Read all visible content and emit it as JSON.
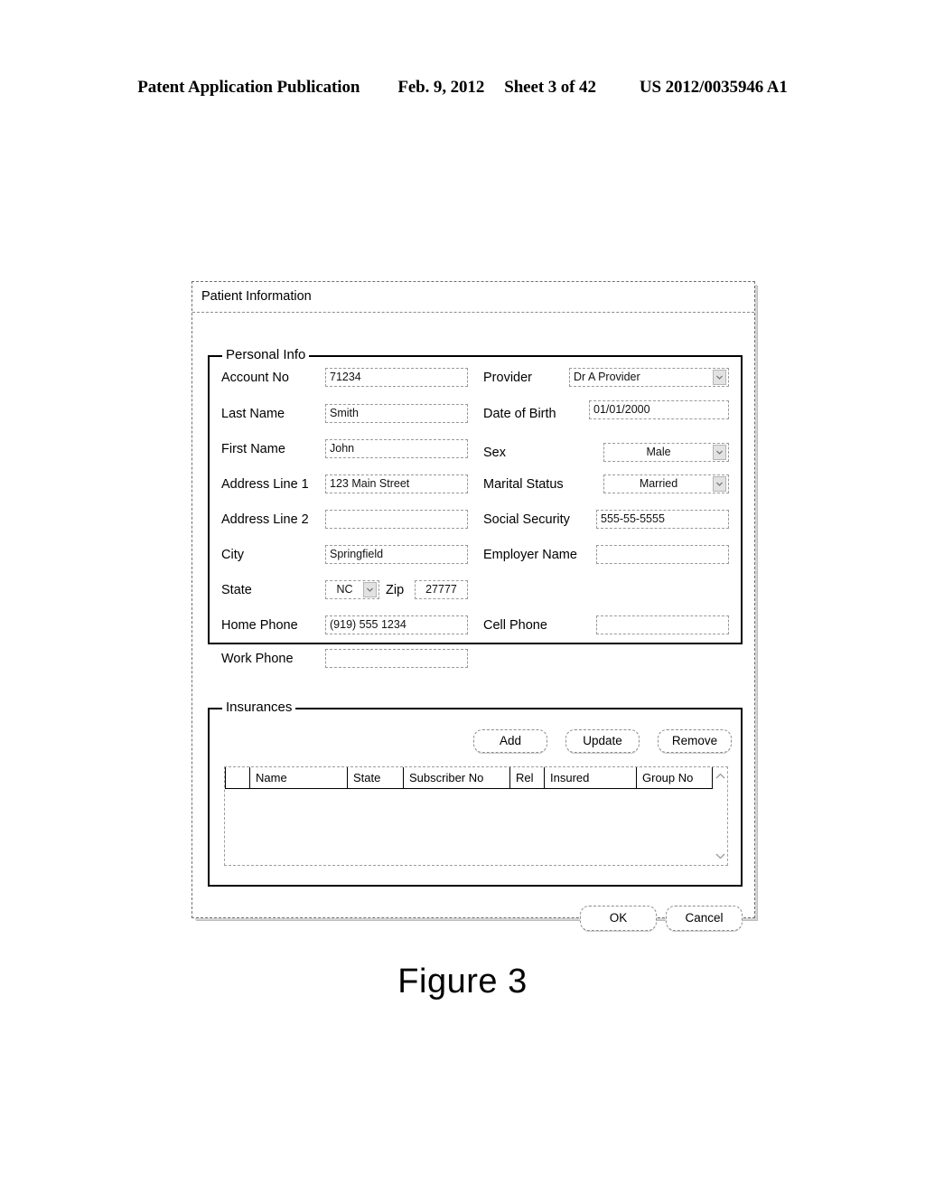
{
  "patent_header": {
    "publication": "Patent Application Publication",
    "date": "Feb. 9, 2012",
    "sheet": "Sheet 3 of 42",
    "number": "US 2012/0035946 A1"
  },
  "figure_caption": "Figure 3",
  "dialog": {
    "title": "Patient Information",
    "personal_info": {
      "legend": "Personal Info",
      "fields": {
        "account_no": {
          "label": "Account No",
          "value": "71234"
        },
        "last_name": {
          "label": "Last Name",
          "value": "Smith"
        },
        "first_name": {
          "label": "First Name",
          "value": "John"
        },
        "address_line_1": {
          "label": "Address Line 1",
          "value": "123 Main Street"
        },
        "address_line_2": {
          "label": "Address Line 2",
          "value": ""
        },
        "city": {
          "label": "City",
          "value": "Springfield"
        },
        "state": {
          "label": "State",
          "value": "NC"
        },
        "zip": {
          "label": "Zip",
          "value": "27777"
        },
        "home_phone": {
          "label": "Home Phone",
          "value": "(919) 555 1234"
        },
        "work_phone": {
          "label": "Work Phone",
          "value": ""
        },
        "provider": {
          "label": "Provider",
          "value": "Dr A Provider"
        },
        "date_of_birth": {
          "label": "Date of Birth",
          "value": "01/01/2000"
        },
        "sex": {
          "label": "Sex",
          "value": "Male"
        },
        "marital_status": {
          "label": "Marital Status",
          "value": "Married"
        },
        "social_security": {
          "label": "Social Security",
          "value": "555-55-5555"
        },
        "employer_name": {
          "label": "Employer Name",
          "value": ""
        },
        "cell_phone": {
          "label": "Cell Phone",
          "value": ""
        }
      }
    },
    "insurances": {
      "legend": "Insurances",
      "buttons": {
        "add": "Add",
        "update": "Update",
        "remove": "Remove"
      },
      "table": {
        "columns": [
          "",
          "Name",
          "State",
          "Subscriber No",
          "Rel",
          "Insured",
          "Group No"
        ],
        "rows": []
      },
      "scroll_up_icon": "chevron-up-icon",
      "scroll_down_icon": "chevron-down-icon"
    },
    "footer": {
      "ok": "OK",
      "cancel": "Cancel"
    }
  }
}
